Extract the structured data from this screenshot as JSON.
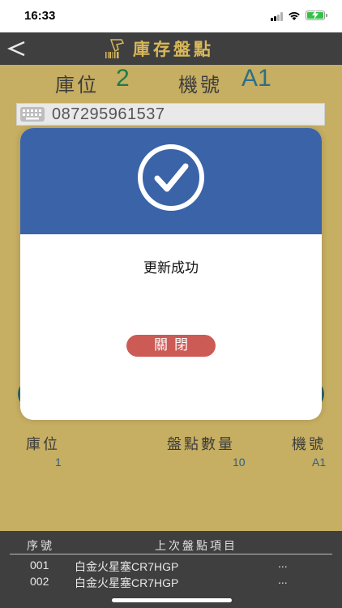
{
  "status_bar": {
    "time": "16:33"
  },
  "nav": {
    "title": "庫存盤點",
    "back_icon": "back-arrow-icon",
    "title_icon": "barcode-scanner-icon"
  },
  "info": {
    "location_label": "庫位",
    "location_value": "2",
    "machine_label": "機號",
    "machine_value": "A1"
  },
  "barcode": {
    "value": "087295961537",
    "icon": "keyboard-icon"
  },
  "modal": {
    "icon": "check-circle-icon",
    "message": "更新成功",
    "close_label": "關閉"
  },
  "summary": {
    "headers": {
      "location": "庫位",
      "count": "盤點數量",
      "machine": "機號"
    },
    "values": {
      "location": "1",
      "count": "10",
      "machine": "A1"
    }
  },
  "history": {
    "headers": {
      "seq": "序號",
      "item": "上次盤點項目"
    },
    "rows": [
      {
        "seq": "001",
        "item": "白金火星塞CR7HGP",
        "more": "..."
      },
      {
        "seq": "002",
        "item": "白金火星塞CR7HGP",
        "more": "..."
      }
    ]
  },
  "colors": {
    "background": "#c6ae62",
    "nav_bar": "#3f3f3f",
    "modal_header": "#3a63a8",
    "close_button": "#cc5a55",
    "title_gold": "#d9b85a"
  }
}
